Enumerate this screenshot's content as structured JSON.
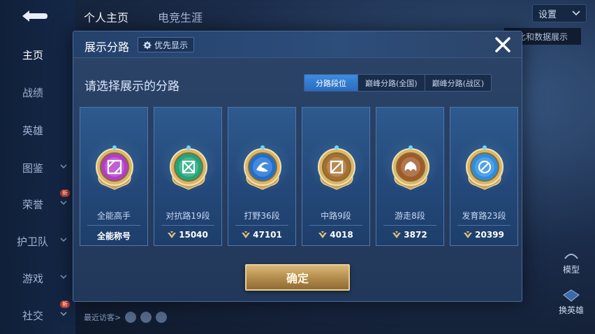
{
  "background": {
    "top_tabs": [
      {
        "label": "个人主页",
        "active": true
      },
      {
        "label": "电竞生涯",
        "active": false
      }
    ],
    "settings_label": "设置",
    "right_label": "比和数据展示",
    "model_label": "模型",
    "switch_hero_label": "换英雄",
    "recent_visitors_label": "最近访客>",
    "sidebar": [
      {
        "label": "主页",
        "active": true,
        "has_chevron": false
      },
      {
        "label": "战绩",
        "active": false,
        "has_chevron": false
      },
      {
        "label": "英雄",
        "active": false,
        "has_chevron": false
      },
      {
        "label": "图鉴",
        "active": false,
        "has_chevron": true
      },
      {
        "label": "荣誉",
        "active": false,
        "has_chevron": true,
        "badge": "新"
      },
      {
        "label": "护卫队",
        "active": false,
        "has_chevron": true
      },
      {
        "label": "游戏",
        "active": false,
        "has_chevron": true
      },
      {
        "label": "社交",
        "active": false,
        "has_chevron": true,
        "badge": "新"
      }
    ]
  },
  "modal": {
    "title": "展示分路",
    "priority_button": "优先显示",
    "subtitle": "请选择展示的分路",
    "tabs": [
      {
        "label": "分路段位",
        "active": true
      },
      {
        "label": "巅峰分路(全国)",
        "active": false
      },
      {
        "label": "巅峰分路(战区)",
        "active": false
      }
    ],
    "lanes": [
      {
        "name": "全能高手",
        "value": "全能称号",
        "has_icon": false,
        "icon": "all-round-icon",
        "emblem_color": "#b23cc9"
      },
      {
        "name": "对抗路19段",
        "value": "15040",
        "has_icon": true,
        "icon": "clash-lane-icon",
        "emblem_color": "#1fa67a"
      },
      {
        "name": "打野36段",
        "value": "47101",
        "has_icon": true,
        "icon": "jungle-icon",
        "emblem_color": "#1d6fd1"
      },
      {
        "name": "中路9段",
        "value": "4018",
        "has_icon": true,
        "icon": "mid-lane-icon",
        "emblem_color": "#a5702f"
      },
      {
        "name": "游走8段",
        "value": "3872",
        "has_icon": true,
        "icon": "roam-icon",
        "emblem_color": "#a05a2a"
      },
      {
        "name": "发育路23段",
        "value": "20399",
        "has_icon": true,
        "icon": "farm-lane-icon",
        "emblem_color": "#2b8ee0"
      }
    ],
    "confirm_label": "确定"
  }
}
